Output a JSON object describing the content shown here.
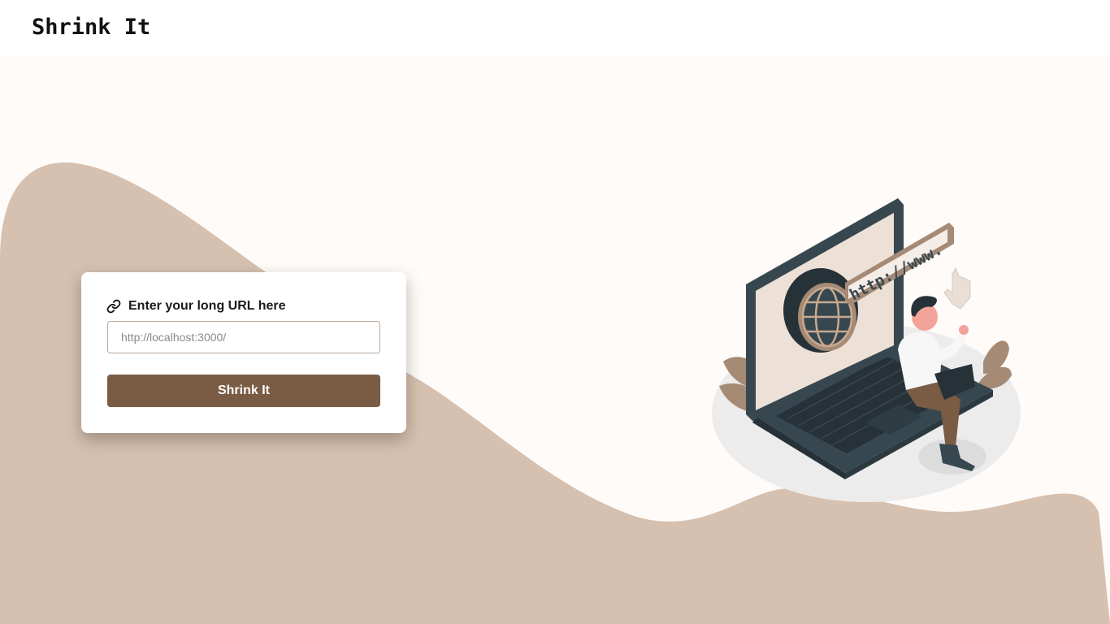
{
  "header": {
    "logo_text": "Shrink It"
  },
  "form": {
    "label": "Enter your long URL here",
    "link_icon": "link-icon",
    "input_placeholder": "http://localhost:3000/",
    "input_value": "",
    "submit_label": "Shrink It"
  },
  "illustration": {
    "url_banner_text": "http://www."
  },
  "colors": {
    "page_background": "#fffbf8",
    "wave": "#d6c0af",
    "button": "#7a5b44",
    "input_border": "#b8a89a"
  }
}
